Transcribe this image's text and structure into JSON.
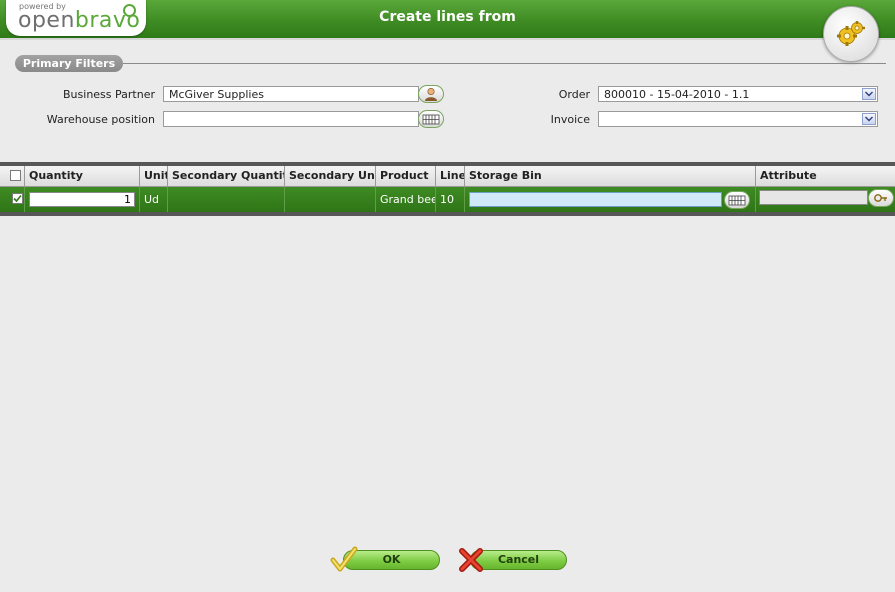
{
  "header": {
    "powered_by": "powered by",
    "logo_text_a": "open",
    "logo_text_b": "bravo",
    "title": "Create lines from"
  },
  "filters": {
    "section_title": "Primary Filters",
    "business_partner_label": "Business Partner",
    "business_partner_value": "McGiver Supplies",
    "warehouse_label": "Warehouse position",
    "warehouse_value": "",
    "order_label": "Order",
    "order_value": "800010 - 15-04-2010 - 1.1",
    "invoice_label": "Invoice",
    "invoice_value": ""
  },
  "grid": {
    "columns": [
      "Quantity",
      "Unit",
      "Secondary Quantity",
      "Secondary Unit",
      "Product",
      "Line",
      "Storage Bin",
      "Attribute"
    ],
    "rows": [
      {
        "selected": true,
        "quantity": "1",
        "unit": "Ud",
        "secondary_quantity": "",
        "secondary_unit": "",
        "product": "Grand beer",
        "line": "10",
        "storage_bin": "",
        "attribute": ""
      }
    ]
  },
  "buttons": {
    "ok": "OK",
    "cancel": "Cancel"
  },
  "colors": {
    "accent_green": "#3f8c24",
    "row_green": "#2f7517"
  }
}
